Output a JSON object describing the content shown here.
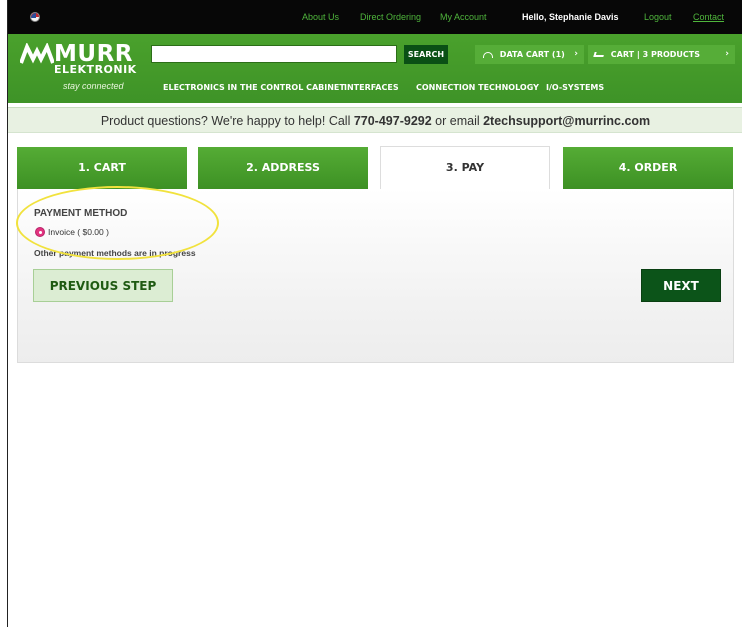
{
  "topbar": {
    "about": "About Us",
    "direct": "Direct Ordering",
    "account": "My Account",
    "user": "Hello, Stephanie Davis",
    "logout": "Logout",
    "contact": "Contact"
  },
  "logo": {
    "line1": "MURR",
    "line2": "ELEKTRONIK",
    "tagline": "stay connected"
  },
  "search": {
    "value": "",
    "button": "SEARCH"
  },
  "data_cart": "DATA CART (1)",
  "cart": "CART | 3 PRODUCTS",
  "nav": {
    "items": [
      "ELECTRONICS IN THE CONTROL CABINET",
      "INTERFACES",
      "CONNECTION TECHNOLOGY",
      "I/O-SYSTEMS"
    ]
  },
  "support": {
    "prefix": "Product questions? We're happy to help! Call ",
    "phone": "770-497-9292",
    "middle": " or email ",
    "email": "2techsupport@murrinc.com"
  },
  "steps": [
    {
      "label": "1. CART",
      "active": false
    },
    {
      "label": "2. ADDRESS",
      "active": false
    },
    {
      "label": "3. PAY",
      "active": true
    },
    {
      "label": "4. ORDER",
      "active": false
    }
  ],
  "payment": {
    "title": "PAYMENT METHOD",
    "option": "Invoice ( $0.00 )",
    "note": "Other payment methods are in progress"
  },
  "buttons": {
    "previous": "PREVIOUS STEP",
    "next": "NEXT"
  },
  "colors": {
    "brand_green": "#4aa12c",
    "dark_green": "#0c5419",
    "radio_pink": "#e2337f",
    "highlight": "#f1e23d"
  }
}
